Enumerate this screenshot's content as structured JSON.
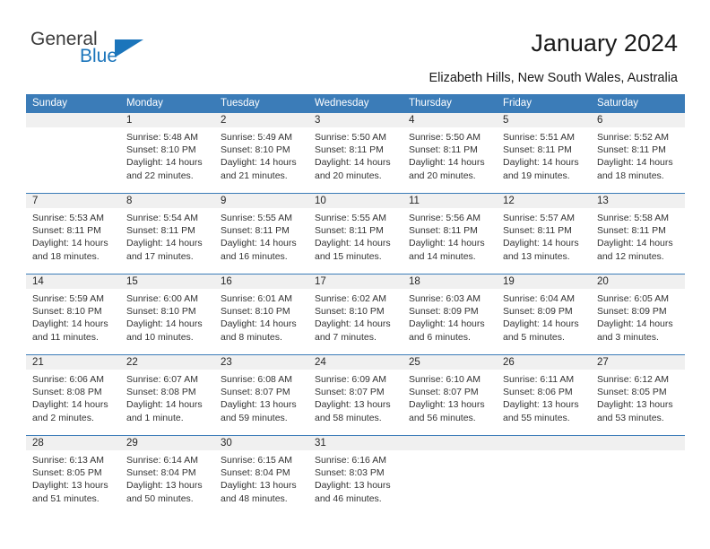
{
  "brand": {
    "name_top": "General",
    "name_bottom": "Blue",
    "triangle_icon": "triangle-logo-icon",
    "color_top": "#3b3b3b",
    "color_bottom": "#1b75bb"
  },
  "header": {
    "title": "January 2024",
    "subtitle": "Elizabeth Hills, New South Wales, Australia"
  },
  "theme": {
    "header_bg": "#3b7cb8",
    "header_text": "#ffffff",
    "daynum_band_bg": "#f0f0f0",
    "body_text": "#333333"
  },
  "weekdays": [
    "Sunday",
    "Monday",
    "Tuesday",
    "Wednesday",
    "Thursday",
    "Friday",
    "Saturday"
  ],
  "weeks": [
    [
      {
        "day": "",
        "empty": true,
        "sunrise": "",
        "sunset": "",
        "daylight_line1": "",
        "daylight_line2": ""
      },
      {
        "day": "1",
        "sunrise": "Sunrise: 5:48 AM",
        "sunset": "Sunset: 8:10 PM",
        "daylight_line1": "Daylight: 14 hours",
        "daylight_line2": "and 22 minutes."
      },
      {
        "day": "2",
        "sunrise": "Sunrise: 5:49 AM",
        "sunset": "Sunset: 8:10 PM",
        "daylight_line1": "Daylight: 14 hours",
        "daylight_line2": "and 21 minutes."
      },
      {
        "day": "3",
        "sunrise": "Sunrise: 5:50 AM",
        "sunset": "Sunset: 8:11 PM",
        "daylight_line1": "Daylight: 14 hours",
        "daylight_line2": "and 20 minutes."
      },
      {
        "day": "4",
        "sunrise": "Sunrise: 5:50 AM",
        "sunset": "Sunset: 8:11 PM",
        "daylight_line1": "Daylight: 14 hours",
        "daylight_line2": "and 20 minutes."
      },
      {
        "day": "5",
        "sunrise": "Sunrise: 5:51 AM",
        "sunset": "Sunset: 8:11 PM",
        "daylight_line1": "Daylight: 14 hours",
        "daylight_line2": "and 19 minutes."
      },
      {
        "day": "6",
        "sunrise": "Sunrise: 5:52 AM",
        "sunset": "Sunset: 8:11 PM",
        "daylight_line1": "Daylight: 14 hours",
        "daylight_line2": "and 18 minutes."
      }
    ],
    [
      {
        "day": "7",
        "sunrise": "Sunrise: 5:53 AM",
        "sunset": "Sunset: 8:11 PM",
        "daylight_line1": "Daylight: 14 hours",
        "daylight_line2": "and 18 minutes."
      },
      {
        "day": "8",
        "sunrise": "Sunrise: 5:54 AM",
        "sunset": "Sunset: 8:11 PM",
        "daylight_line1": "Daylight: 14 hours",
        "daylight_line2": "and 17 minutes."
      },
      {
        "day": "9",
        "sunrise": "Sunrise: 5:55 AM",
        "sunset": "Sunset: 8:11 PM",
        "daylight_line1": "Daylight: 14 hours",
        "daylight_line2": "and 16 minutes."
      },
      {
        "day": "10",
        "sunrise": "Sunrise: 5:55 AM",
        "sunset": "Sunset: 8:11 PM",
        "daylight_line1": "Daylight: 14 hours",
        "daylight_line2": "and 15 minutes."
      },
      {
        "day": "11",
        "sunrise": "Sunrise: 5:56 AM",
        "sunset": "Sunset: 8:11 PM",
        "daylight_line1": "Daylight: 14 hours",
        "daylight_line2": "and 14 minutes."
      },
      {
        "day": "12",
        "sunrise": "Sunrise: 5:57 AM",
        "sunset": "Sunset: 8:11 PM",
        "daylight_line1": "Daylight: 14 hours",
        "daylight_line2": "and 13 minutes."
      },
      {
        "day": "13",
        "sunrise": "Sunrise: 5:58 AM",
        "sunset": "Sunset: 8:11 PM",
        "daylight_line1": "Daylight: 14 hours",
        "daylight_line2": "and 12 minutes."
      }
    ],
    [
      {
        "day": "14",
        "sunrise": "Sunrise: 5:59 AM",
        "sunset": "Sunset: 8:10 PM",
        "daylight_line1": "Daylight: 14 hours",
        "daylight_line2": "and 11 minutes."
      },
      {
        "day": "15",
        "sunrise": "Sunrise: 6:00 AM",
        "sunset": "Sunset: 8:10 PM",
        "daylight_line1": "Daylight: 14 hours",
        "daylight_line2": "and 10 minutes."
      },
      {
        "day": "16",
        "sunrise": "Sunrise: 6:01 AM",
        "sunset": "Sunset: 8:10 PM",
        "daylight_line1": "Daylight: 14 hours",
        "daylight_line2": "and 8 minutes."
      },
      {
        "day": "17",
        "sunrise": "Sunrise: 6:02 AM",
        "sunset": "Sunset: 8:10 PM",
        "daylight_line1": "Daylight: 14 hours",
        "daylight_line2": "and 7 minutes."
      },
      {
        "day": "18",
        "sunrise": "Sunrise: 6:03 AM",
        "sunset": "Sunset: 8:09 PM",
        "daylight_line1": "Daylight: 14 hours",
        "daylight_line2": "and 6 minutes."
      },
      {
        "day": "19",
        "sunrise": "Sunrise: 6:04 AM",
        "sunset": "Sunset: 8:09 PM",
        "daylight_line1": "Daylight: 14 hours",
        "daylight_line2": "and 5 minutes."
      },
      {
        "day": "20",
        "sunrise": "Sunrise: 6:05 AM",
        "sunset": "Sunset: 8:09 PM",
        "daylight_line1": "Daylight: 14 hours",
        "daylight_line2": "and 3 minutes."
      }
    ],
    [
      {
        "day": "21",
        "sunrise": "Sunrise: 6:06 AM",
        "sunset": "Sunset: 8:08 PM",
        "daylight_line1": "Daylight: 14 hours",
        "daylight_line2": "and 2 minutes."
      },
      {
        "day": "22",
        "sunrise": "Sunrise: 6:07 AM",
        "sunset": "Sunset: 8:08 PM",
        "daylight_line1": "Daylight: 14 hours",
        "daylight_line2": "and 1 minute."
      },
      {
        "day": "23",
        "sunrise": "Sunrise: 6:08 AM",
        "sunset": "Sunset: 8:07 PM",
        "daylight_line1": "Daylight: 13 hours",
        "daylight_line2": "and 59 minutes."
      },
      {
        "day": "24",
        "sunrise": "Sunrise: 6:09 AM",
        "sunset": "Sunset: 8:07 PM",
        "daylight_line1": "Daylight: 13 hours",
        "daylight_line2": "and 58 minutes."
      },
      {
        "day": "25",
        "sunrise": "Sunrise: 6:10 AM",
        "sunset": "Sunset: 8:07 PM",
        "daylight_line1": "Daylight: 13 hours",
        "daylight_line2": "and 56 minutes."
      },
      {
        "day": "26",
        "sunrise": "Sunrise: 6:11 AM",
        "sunset": "Sunset: 8:06 PM",
        "daylight_line1": "Daylight: 13 hours",
        "daylight_line2": "and 55 minutes."
      },
      {
        "day": "27",
        "sunrise": "Sunrise: 6:12 AM",
        "sunset": "Sunset: 8:05 PM",
        "daylight_line1": "Daylight: 13 hours",
        "daylight_line2": "and 53 minutes."
      }
    ],
    [
      {
        "day": "28",
        "sunrise": "Sunrise: 6:13 AM",
        "sunset": "Sunset: 8:05 PM",
        "daylight_line1": "Daylight: 13 hours",
        "daylight_line2": "and 51 minutes."
      },
      {
        "day": "29",
        "sunrise": "Sunrise: 6:14 AM",
        "sunset": "Sunset: 8:04 PM",
        "daylight_line1": "Daylight: 13 hours",
        "daylight_line2": "and 50 minutes."
      },
      {
        "day": "30",
        "sunrise": "Sunrise: 6:15 AM",
        "sunset": "Sunset: 8:04 PM",
        "daylight_line1": "Daylight: 13 hours",
        "daylight_line2": "and 48 minutes."
      },
      {
        "day": "31",
        "sunrise": "Sunrise: 6:16 AM",
        "sunset": "Sunset: 8:03 PM",
        "daylight_line1": "Daylight: 13 hours",
        "daylight_line2": "and 46 minutes."
      },
      {
        "day": "",
        "empty": true,
        "sunrise": "",
        "sunset": "",
        "daylight_line1": "",
        "daylight_line2": ""
      },
      {
        "day": "",
        "empty": true,
        "sunrise": "",
        "sunset": "",
        "daylight_line1": "",
        "daylight_line2": ""
      },
      {
        "day": "",
        "empty": true,
        "sunrise": "",
        "sunset": "",
        "daylight_line1": "",
        "daylight_line2": ""
      }
    ]
  ]
}
